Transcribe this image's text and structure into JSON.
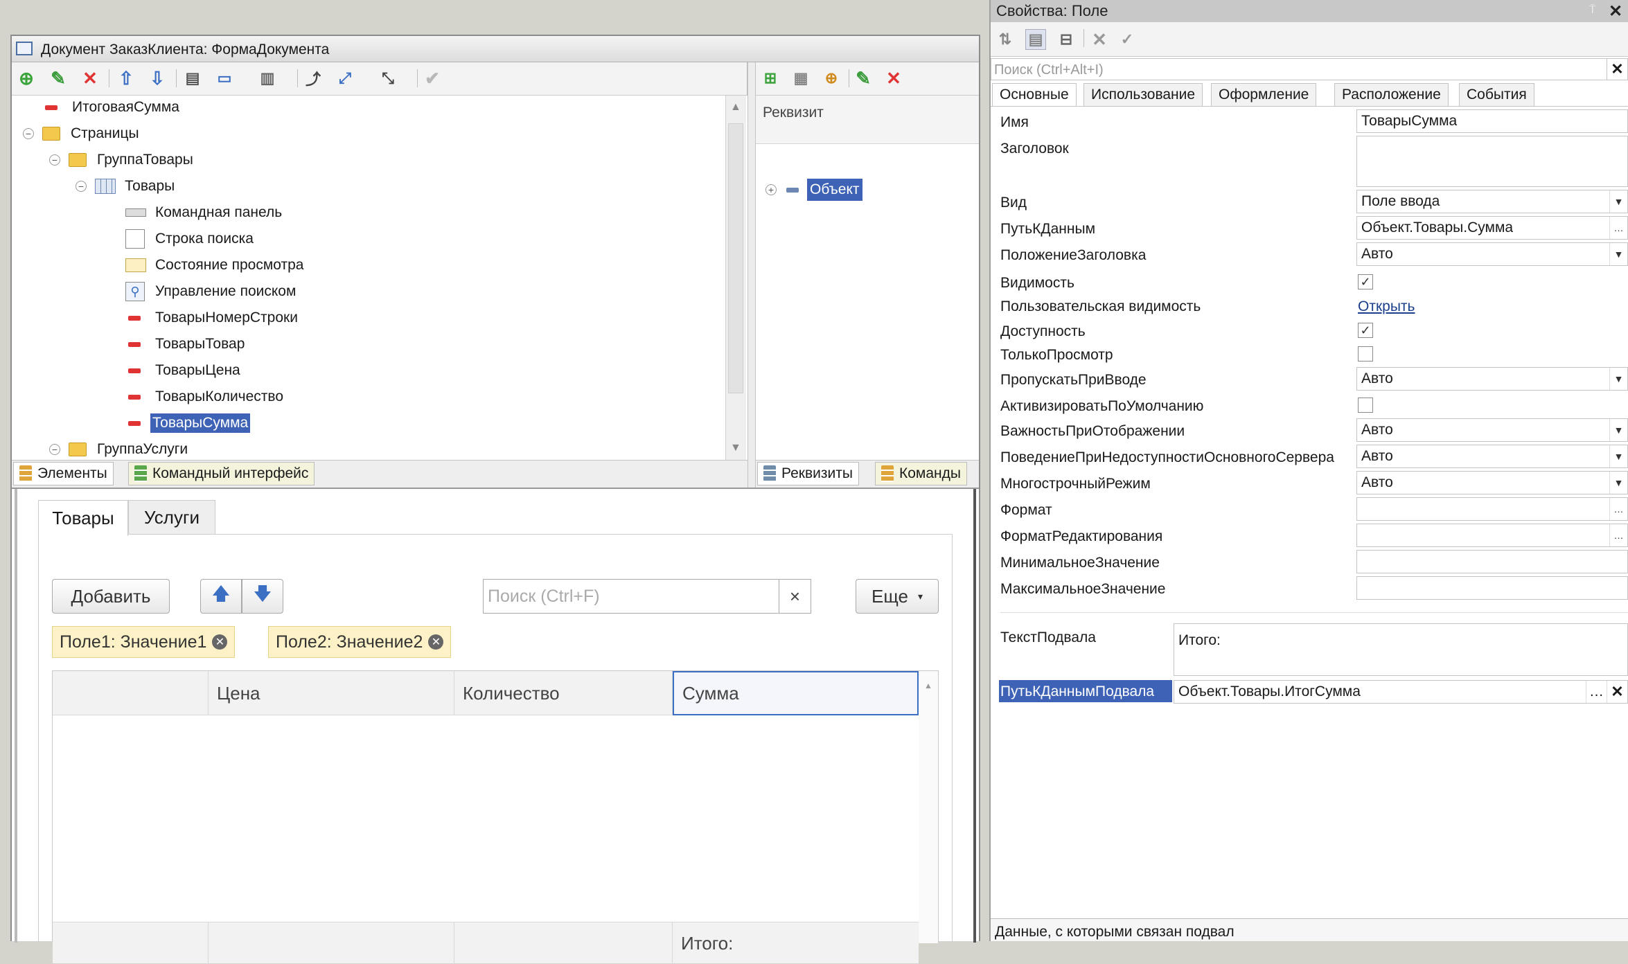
{
  "left_window": {
    "title": "Документ ЗаказКлиента: ФормаДокумента",
    "tree": [
      {
        "label": "ИтоговаяСумма"
      },
      {
        "label": "Страницы"
      },
      {
        "label": "ГруппаТовары"
      },
      {
        "label": "Товары"
      },
      {
        "label": "Командная панель"
      },
      {
        "label": "Строка поиска"
      },
      {
        "label": "Состояние просмотра"
      },
      {
        "label": "Управление поиском"
      },
      {
        "label": "ТоварыНомерСтроки"
      },
      {
        "label": "ТоварыТовар"
      },
      {
        "label": "ТоварыЦена"
      },
      {
        "label": "ТоварыКоличество"
      },
      {
        "label": "ТоварыСумма",
        "selected": true
      },
      {
        "label": "ГруппаУслуги"
      }
    ],
    "bottom_tabs": [
      "Элементы",
      "Командный интерфейс"
    ],
    "attributes": {
      "header": "Реквизит",
      "root": "Объект",
      "tabs": [
        "Реквизиты",
        "Команды"
      ]
    }
  },
  "form_preview": {
    "tabs": [
      "Товары",
      "Услуги"
    ],
    "add_button": "Добавить",
    "search_placeholder": "Поиск (Ctrl+F)",
    "search_clear": "×",
    "more_button": "Еще",
    "filters": [
      "Поле1: Значение1",
      "Поле2: Значение2"
    ],
    "columns": [
      "Цена",
      "Количество",
      "Сумма"
    ],
    "footer_text": "Итого:"
  },
  "properties": {
    "title": "Свойства: Поле",
    "pin_icon": "⍑",
    "close_icon": "✕",
    "search_placeholder": "Поиск (Ctrl+Alt+I)",
    "tabs": [
      "Основные",
      "Использование",
      "Оформление",
      "Расположение",
      "События"
    ],
    "rows": {
      "name_label": "Имя",
      "name_value": "ТоварыСумма",
      "title_label": "Заголовок",
      "kind_label": "Вид",
      "kind_value": "Поле ввода",
      "path_label": "ПутьКДанным",
      "path_value": "Объект.Товары.Сумма",
      "titlepos_label": "ПоложениеЗаголовка",
      "titlepos_value": "Авто",
      "visible_label": "Видимость",
      "uservis_label": "Пользовательская видимость",
      "uservis_link": "Открыть",
      "enabled_label": "Доступность",
      "readonly_label": "ТолькоПросмотр",
      "skip_label": "ПропускатьПриВводе",
      "skip_value": "Авто",
      "activate_label": "АктивизироватьПоУмолчанию",
      "importance_label": "ВажностьПриОтображении",
      "importance_value": "Авто",
      "behavior_label": "ПоведениеПриНедоступностиОсновногоСервера",
      "behavior_value": "Авто",
      "multiline_label": "МногострочныйРежим",
      "multiline_value": "Авто",
      "format_label": "Формат",
      "editformat_label": "ФорматРедактирования",
      "min_label": "МинимальноеЗначение",
      "max_label": "МаксимальноеЗначение",
      "footer_label": "ТекстПодвала",
      "footer_value": "Итого:",
      "footerpath_label": "ПутьКДаннымПодвала",
      "footerpath_value": "Объект.Товары.ИтогСумма"
    },
    "checkboxes": {
      "visible": true,
      "enabled": true,
      "readonly": false,
      "activate": false
    },
    "status": "Данные, с которыми связан подвал"
  }
}
